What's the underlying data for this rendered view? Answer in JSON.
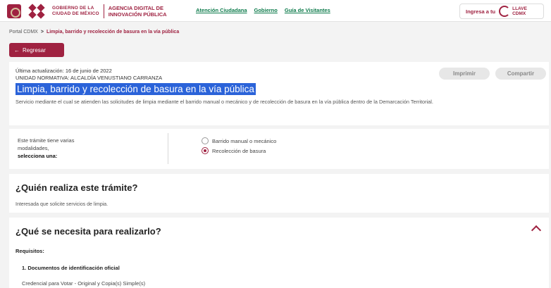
{
  "header": {
    "gov_line1": "GOBIERNO DE LA",
    "gov_line2": "CIUDAD DE MÉXICO",
    "agency_line1": "AGENCIA DIGITAL DE",
    "agency_line2": "INNOVACIÓN PÚBLICA",
    "nav": [
      "Atención Ciudadana",
      "Gobierno",
      "Guía de Visitantes"
    ],
    "login_label": "Ingresa a tu",
    "llave_line1": "LLAVE",
    "llave_line2": "CDMX"
  },
  "breadcrumb": {
    "root": "Portal CDMX",
    "separator": ">",
    "current": "Limpia, barrido y recolección de basura en la vía pública"
  },
  "back_button": {
    "arrow": "←",
    "label": "Regresar"
  },
  "summary": {
    "updated": "Última actualización: 16 de junio de 2022",
    "normative": "UNIDAD NORMATIVA: ALCALDÍA VENUSTIANO CARRANZA",
    "title": "Limpia, barrido y recolección de basura en la vía pública",
    "description": "Servicio mediante el cual se atienden las solicitudes de limpia mediante el barrido manual o mecánico y de recolección de basura en la vía pública dentro de la Demarcación Territorial.",
    "print_label": "Imprimir",
    "share_label": "Compartir"
  },
  "modalities": {
    "line1": "Este trámite tiene varias",
    "line2": "modalidades,",
    "line3": "selecciona una:",
    "options": [
      {
        "label": "Barrido manual o mecánico",
        "checked": false
      },
      {
        "label": "Recolección de basura",
        "checked": true
      }
    ]
  },
  "who": {
    "heading": "¿Quién realiza este trámite?",
    "text": "Interesada que solicite servicios de limpia."
  },
  "needs": {
    "heading": "¿Qué se necesita para realizarlo?",
    "requirements_label": "Requisitos:",
    "doc_title": "1. Documentos de identificación oficial",
    "doc_item": "Credencial para Votar - Original y Copia(s) Simple(s)"
  }
}
